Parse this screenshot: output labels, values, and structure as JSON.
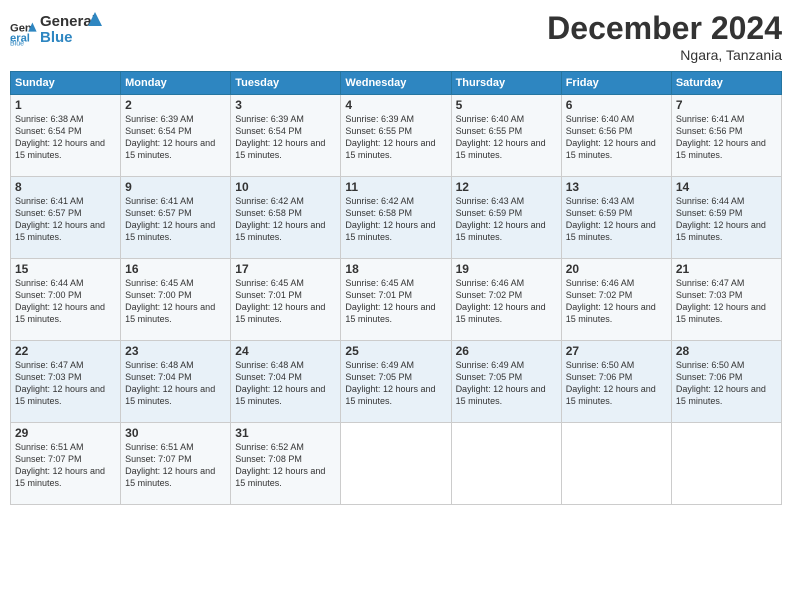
{
  "header": {
    "logo_line1": "General",
    "logo_line2": "Blue",
    "main_title": "December 2024",
    "subtitle": "Ngara, Tanzania"
  },
  "calendar": {
    "days_of_week": [
      "Sunday",
      "Monday",
      "Tuesday",
      "Wednesday",
      "Thursday",
      "Friday",
      "Saturday"
    ],
    "weeks": [
      [
        null,
        {
          "day": 2,
          "sunrise": "Sunrise: 6:39 AM",
          "sunset": "Sunset: 6:54 PM",
          "daylight": "Daylight: 12 hours and 15 minutes."
        },
        {
          "day": 3,
          "sunrise": "Sunrise: 6:39 AM",
          "sunset": "Sunset: 6:54 PM",
          "daylight": "Daylight: 12 hours and 15 minutes."
        },
        {
          "day": 4,
          "sunrise": "Sunrise: 6:39 AM",
          "sunset": "Sunset: 6:55 PM",
          "daylight": "Daylight: 12 hours and 15 minutes."
        },
        {
          "day": 5,
          "sunrise": "Sunrise: 6:40 AM",
          "sunset": "Sunset: 6:55 PM",
          "daylight": "Daylight: 12 hours and 15 minutes."
        },
        {
          "day": 6,
          "sunrise": "Sunrise: 6:40 AM",
          "sunset": "Sunset: 6:56 PM",
          "daylight": "Daylight: 12 hours and 15 minutes."
        },
        {
          "day": 7,
          "sunrise": "Sunrise: 6:41 AM",
          "sunset": "Sunset: 6:56 PM",
          "daylight": "Daylight: 12 hours and 15 minutes."
        }
      ],
      [
        {
          "day": 1,
          "sunrise": "Sunrise: 6:38 AM",
          "sunset": "Sunset: 6:54 PM",
          "daylight": "Daylight: 12 hours and 15 minutes."
        },
        null,
        null,
        null,
        null,
        null,
        null
      ],
      [
        {
          "day": 8,
          "sunrise": "Sunrise: 6:41 AM",
          "sunset": "Sunset: 6:57 PM",
          "daylight": "Daylight: 12 hours and 15 minutes."
        },
        {
          "day": 9,
          "sunrise": "Sunrise: 6:41 AM",
          "sunset": "Sunset: 6:57 PM",
          "daylight": "Daylight: 12 hours and 15 minutes."
        },
        {
          "day": 10,
          "sunrise": "Sunrise: 6:42 AM",
          "sunset": "Sunset: 6:58 PM",
          "daylight": "Daylight: 12 hours and 15 minutes."
        },
        {
          "day": 11,
          "sunrise": "Sunrise: 6:42 AM",
          "sunset": "Sunset: 6:58 PM",
          "daylight": "Daylight: 12 hours and 15 minutes."
        },
        {
          "day": 12,
          "sunrise": "Sunrise: 6:43 AM",
          "sunset": "Sunset: 6:59 PM",
          "daylight": "Daylight: 12 hours and 15 minutes."
        },
        {
          "day": 13,
          "sunrise": "Sunrise: 6:43 AM",
          "sunset": "Sunset: 6:59 PM",
          "daylight": "Daylight: 12 hours and 15 minutes."
        },
        {
          "day": 14,
          "sunrise": "Sunrise: 6:44 AM",
          "sunset": "Sunset: 6:59 PM",
          "daylight": "Daylight: 12 hours and 15 minutes."
        }
      ],
      [
        {
          "day": 15,
          "sunrise": "Sunrise: 6:44 AM",
          "sunset": "Sunset: 7:00 PM",
          "daylight": "Daylight: 12 hours and 15 minutes."
        },
        {
          "day": 16,
          "sunrise": "Sunrise: 6:45 AM",
          "sunset": "Sunset: 7:00 PM",
          "daylight": "Daylight: 12 hours and 15 minutes."
        },
        {
          "day": 17,
          "sunrise": "Sunrise: 6:45 AM",
          "sunset": "Sunset: 7:01 PM",
          "daylight": "Daylight: 12 hours and 15 minutes."
        },
        {
          "day": 18,
          "sunrise": "Sunrise: 6:45 AM",
          "sunset": "Sunset: 7:01 PM",
          "daylight": "Daylight: 12 hours and 15 minutes."
        },
        {
          "day": 19,
          "sunrise": "Sunrise: 6:46 AM",
          "sunset": "Sunset: 7:02 PM",
          "daylight": "Daylight: 12 hours and 15 minutes."
        },
        {
          "day": 20,
          "sunrise": "Sunrise: 6:46 AM",
          "sunset": "Sunset: 7:02 PM",
          "daylight": "Daylight: 12 hours and 15 minutes."
        },
        {
          "day": 21,
          "sunrise": "Sunrise: 6:47 AM",
          "sunset": "Sunset: 7:03 PM",
          "daylight": "Daylight: 12 hours and 15 minutes."
        }
      ],
      [
        {
          "day": 22,
          "sunrise": "Sunrise: 6:47 AM",
          "sunset": "Sunset: 7:03 PM",
          "daylight": "Daylight: 12 hours and 15 minutes."
        },
        {
          "day": 23,
          "sunrise": "Sunrise: 6:48 AM",
          "sunset": "Sunset: 7:04 PM",
          "daylight": "Daylight: 12 hours and 15 minutes."
        },
        {
          "day": 24,
          "sunrise": "Sunrise: 6:48 AM",
          "sunset": "Sunset: 7:04 PM",
          "daylight": "Daylight: 12 hours and 15 minutes."
        },
        {
          "day": 25,
          "sunrise": "Sunrise: 6:49 AM",
          "sunset": "Sunset: 7:05 PM",
          "daylight": "Daylight: 12 hours and 15 minutes."
        },
        {
          "day": 26,
          "sunrise": "Sunrise: 6:49 AM",
          "sunset": "Sunset: 7:05 PM",
          "daylight": "Daylight: 12 hours and 15 minutes."
        },
        {
          "day": 27,
          "sunrise": "Sunrise: 6:50 AM",
          "sunset": "Sunset: 7:06 PM",
          "daylight": "Daylight: 12 hours and 15 minutes."
        },
        {
          "day": 28,
          "sunrise": "Sunrise: 6:50 AM",
          "sunset": "Sunset: 7:06 PM",
          "daylight": "Daylight: 12 hours and 15 minutes."
        }
      ],
      [
        {
          "day": 29,
          "sunrise": "Sunrise: 6:51 AM",
          "sunset": "Sunset: 7:07 PM",
          "daylight": "Daylight: 12 hours and 15 minutes."
        },
        {
          "day": 30,
          "sunrise": "Sunrise: 6:51 AM",
          "sunset": "Sunset: 7:07 PM",
          "daylight": "Daylight: 12 hours and 15 minutes."
        },
        {
          "day": 31,
          "sunrise": "Sunrise: 6:52 AM",
          "sunset": "Sunset: 7:08 PM",
          "daylight": "Daylight: 12 hours and 15 minutes."
        },
        null,
        null,
        null,
        null
      ]
    ]
  }
}
